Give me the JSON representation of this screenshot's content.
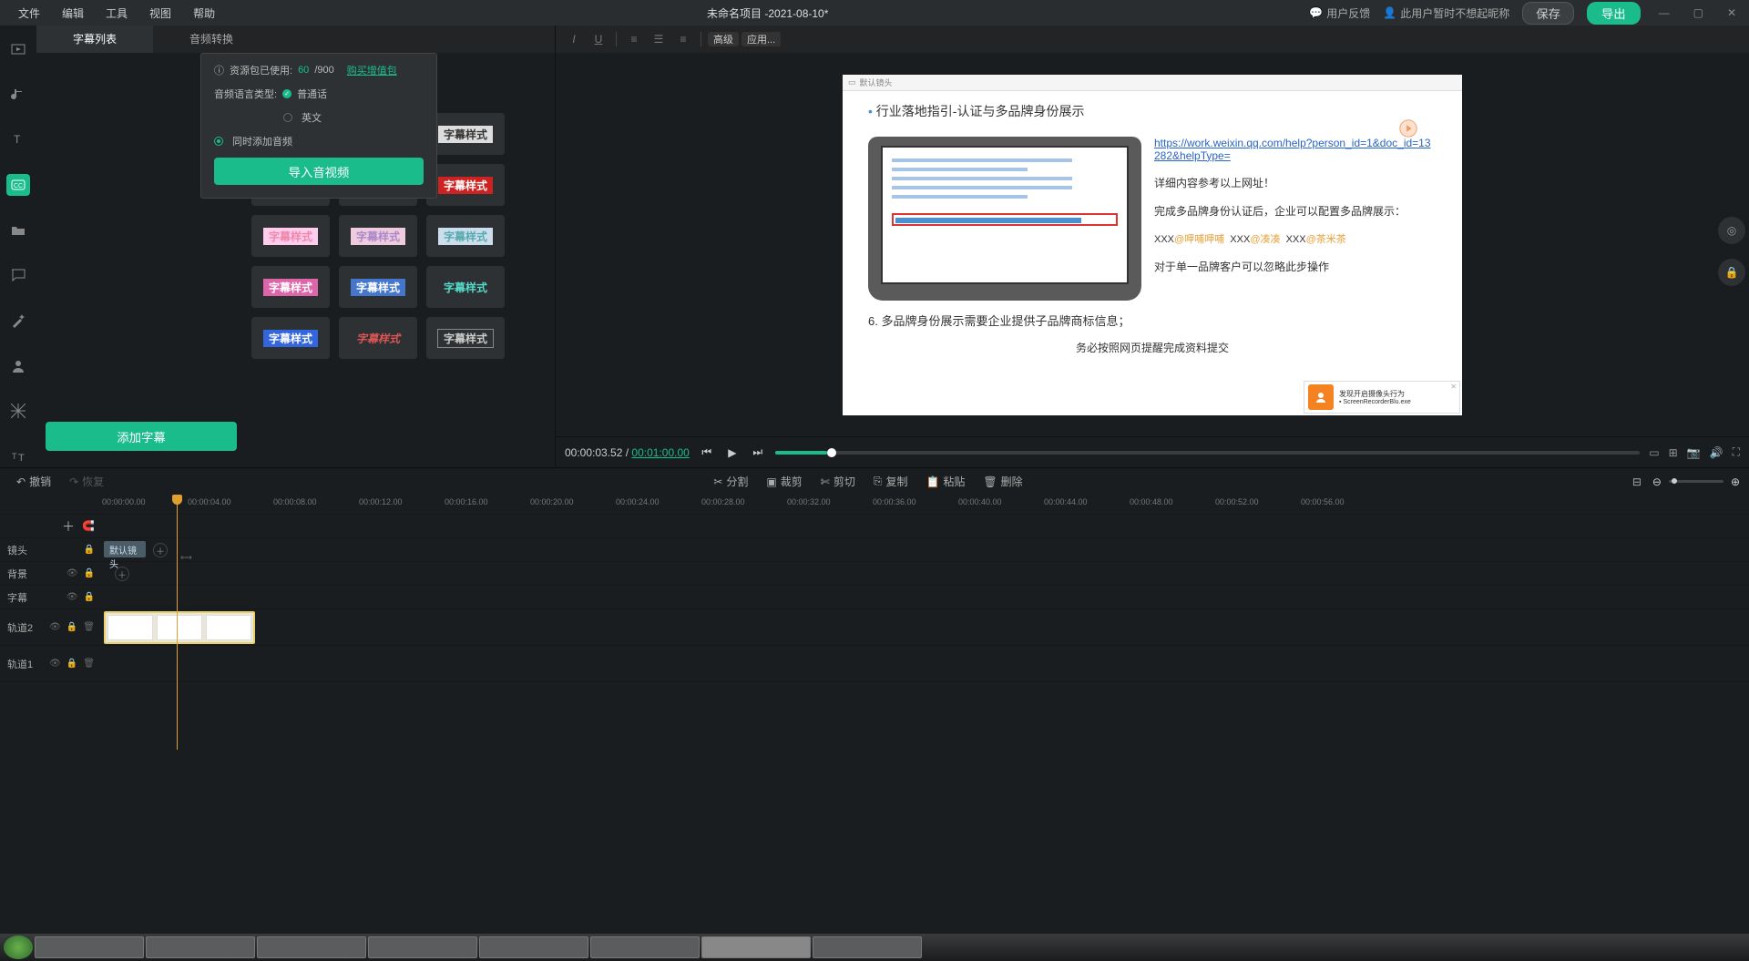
{
  "menubar": {
    "items": [
      "文件",
      "编辑",
      "工具",
      "视图",
      "帮助"
    ],
    "title": "未命名项目 -2021-08-10*",
    "feedback": "用户反馈",
    "nickname": "此用户暂时不想起昵称",
    "save": "保存",
    "export": "导出"
  },
  "sidebar": {
    "active_index": 3
  },
  "tabs": {
    "list": "字幕列表",
    "convert": "音频转换"
  },
  "popup": {
    "usage_label": "资源包已使用:",
    "used": "60",
    "total": "/900",
    "buy": "购买增值包",
    "lang_label": "音频语言类型:",
    "mandarin": "普通话",
    "english": "英文",
    "add_audio": "同时添加音频",
    "import_btn": "导入音视频"
  },
  "add_subtitle_btn": "添加字幕",
  "style_label": "字幕样式",
  "opt_advanced": "高级",
  "opt_apply": "应用...",
  "preview": {
    "tab": "默认镜头",
    "heading": "行业落地指引-认证与多品牌身份展示",
    "link": "https://work.weixin.qq.com/help?person_id=1&doc_id=13282&helpType=",
    "para1": "详细内容参考以上网址！",
    "para2": "完成多品牌身份认证后，企业可以配置多品牌展示：",
    "brands": "XXX@呷哺呷哺  XXX@凑凑  XXX@茶米茶",
    "para3": "对于单一品牌客户可以忽略此步操作",
    "num6": "6. 多品牌身份展示需要企业提供子品牌商标信息；",
    "sub6": "务必按照网页提醒完成资料提交",
    "notif_title": "发现开启摄像头行为",
    "notif_file": "ScreenRecorderBlu.exe"
  },
  "playback": {
    "current": "00:00:03.52",
    "sep": " / ",
    "duration": "00:01:00.00"
  },
  "tl_toolbar": {
    "undo": "撤销",
    "redo": "恢复",
    "split": "分割",
    "crop": "裁剪",
    "cut": "剪切",
    "copy": "复制",
    "paste": "粘贴",
    "delete": "删除"
  },
  "ruler_ticks": [
    "00:00:00.00",
    "00:00:04.00",
    "00:00:08.00",
    "00:00:12.00",
    "00:00:16.00",
    "00:00:20.00",
    "00:00:24.00",
    "00:00:28.00",
    "00:00:32.00",
    "00:00:36.00",
    "00:00:40.00",
    "00:00:44.00",
    "00:00:48.00",
    "00:00:52.00",
    "00:00:56.00"
  ],
  "tracks": {
    "lens": "镜头",
    "bg": "背景",
    "sub": "字幕",
    "t2": "轨道2",
    "t1": "轨道1",
    "lens_clip": "默认镜头"
  }
}
